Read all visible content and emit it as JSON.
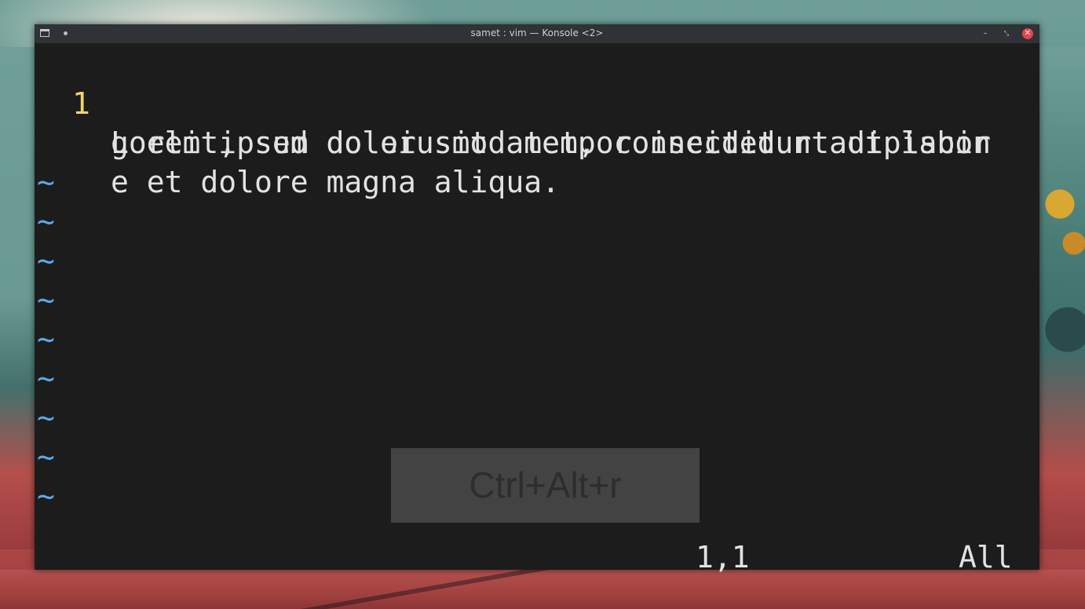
{
  "window": {
    "title": "samet : vim — Konsole <2>",
    "app_icon": "terminal-icon",
    "pin_icon": "dot-icon",
    "buttons": {
      "minimize": "–",
      "maximize": "⤡",
      "close": "✕"
    }
  },
  "editor": {
    "line_number": "1",
    "wrapped_lines": [
      "Lorem ipsum dolor sit amet, consectetur adipiscin",
      "g elit, sed do eiusmod tempor incididunt ut labor",
      "e et dolore magna aliqua."
    ],
    "empty_line_marker": "~",
    "status": {
      "position": "1,1",
      "scroll": "All"
    }
  },
  "key_overlay": {
    "text": "Ctrl+Alt+r"
  },
  "colors": {
    "line_number": "#f0d66a",
    "tilde": "#5ea8e6",
    "text": "#e2e2e2",
    "background": "#1c1c1c",
    "close_button": "#e0474c"
  }
}
